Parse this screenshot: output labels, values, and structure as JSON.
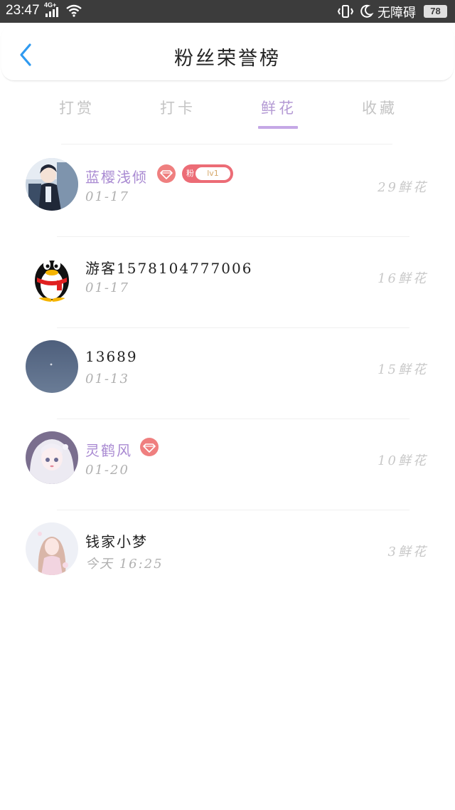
{
  "status_bar": {
    "time": "23:47",
    "network": "4G+",
    "accessibility": "无障碍",
    "battery": "78"
  },
  "header": {
    "title": "粉丝荣誉榜"
  },
  "tabs": [
    {
      "label": "打赏",
      "active": false
    },
    {
      "label": "打卡",
      "active": false
    },
    {
      "label": "鲜花",
      "active": true
    },
    {
      "label": "收藏",
      "active": false
    }
  ],
  "fans": [
    {
      "name": "蓝樱浅倾",
      "date": "01-17",
      "count": "29鲜花",
      "vip": true,
      "fan_badge": {
        "label": "粉",
        "level": "lv1"
      }
    },
    {
      "name": "游客1578104777006",
      "date": "01-17",
      "count": "16鲜花",
      "vip": false
    },
    {
      "name": "13689",
      "date": "01-13",
      "count": "15鲜花",
      "vip": false
    },
    {
      "name": "灵鹤风",
      "date": "01-20",
      "count": "10鲜花",
      "vip": true
    },
    {
      "name": "钱家小梦",
      "date": "今天 16:25",
      "count": "3鲜花",
      "vip": false
    }
  ],
  "colors": {
    "accent": "#b49ad4",
    "tab_underline": "#c5a8e6",
    "vip_name": "#a98ad2",
    "badge_red": "#ec6c76",
    "back_arrow": "#2f9af0",
    "muted_text": "#b0b0b0"
  },
  "icons": {
    "back": "chevron-left-icon",
    "vip": "diamond-icon"
  }
}
